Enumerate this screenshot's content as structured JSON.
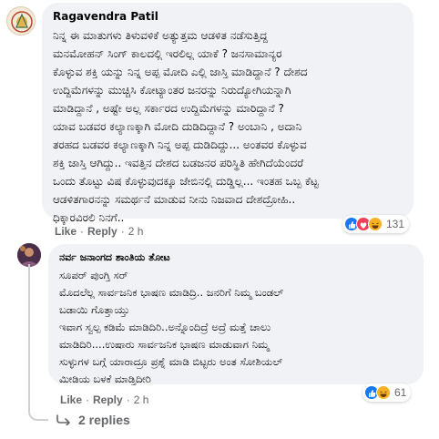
{
  "comment1": {
    "author": "Ragavendra Patil",
    "text": "ನಿನ್ನ ಈ ಮಾತುಗಳು ತಿಳುವಳಿಕೆ ಅತ್ಯುತ್ತಮ ಆಡಳಿತ ನಡೆಸುತ್ತಿದ್ದ\nಮನಮೋಹನ್ ಸಿಂಗ್ ಕಾಲದಲ್ಲಿ ಇರಲಿಲ್ಲ ಯಾಕೆ ? ಜನಸಾಮಾನ್ಯರ\nಕೊಳ್ಳುವ ಶಕ್ತಿ ಯನ್ನು ನಿನ್ನ ಅಪ್ಪ ಮೋದಿ ಎಲ್ಲಿ ಜಾಸ್ತಿ ಮಾಡಿದ್ದಾನೆ ? ದೇಶದ\nಉದ್ದಿಮೆಗಳನ್ನು ಮುಚ್ಚಿಸಿ ಕೋಟ್ಯಾಂತರ ಜನರನ್ನು ನಿರುದ್ಯೋಗಿಯನ್ನಾಗಿ\nಮಾಡಿದ್ದಾನೆ , ಅಷ್ಟೇ ಅಲ್ಲ ಸರ್ಕಾರದ ಉದ್ದಿಮೆಗಳನ್ನು ಮಾರಿದ್ದಾನೆ ?\nಯಾವ ಬಡವರ ಕಲ್ಯಾಣಕ್ಕಾಗಿ ಮೋದಿ ದುಡಿದಿದ್ದಾನೆ ? ಅಂಬಾನಿ , ಅದಾನಿ\nತರಹದ ಬಡವರ ಕಲ್ಯಾಣಕ್ಕಾಗಿ ನಿನ್ನ ಅಪ್ಪ ದುಡಿದಿದ್ದು... ಅಂತವರ ಕೊಳ್ಳುವ\nಶಕ್ತಿ ಜಾಸ್ತಿ ಆಗಿದ್ದು.. ಇವತ್ತಿನ ದೇಶದ ಬಡಜನರ ಪರಿಸ್ಥಿತಿ ಹೇಗಿದೆಯೆಂದರೆ\nಒಂದು ತೊಟ್ಟು ವಿಷ ಕೊಳ್ಳುವುದಕ್ಕೂ ಜೇಬಿನಲ್ಲಿ ದುಡ್ಡಿಲ್ಲ... ಇಂತಹ ಒಬ್ಬ ಕೆಟ್ಟ\nಆಡಳಿತಗಾರನನ್ನು ಸಮರ್ಥನೆ ಮಾಡುವ ನೀನು ನಿಜವಾದ ದೇಶದ್ರೋಹಿ..\nಧಿಕ್ಕಾರವಿರಲಿ ನಿನಗೆ..",
    "like_label": "Like",
    "reply_label": "Reply",
    "separator": "·",
    "time": "2 h",
    "reaction_count": "131",
    "reactions": [
      "like",
      "love",
      "haha"
    ]
  },
  "comment2": {
    "author": "ನರ್ವ ಜನಾಂಗದ ಶಾಂತಿಯ ತೋಟ",
    "text": "ಸೂಪರ್ ಪುಂಗ್ತಿ ಸರ್\nಮೊದಲೆಲ್ಲ ಸಾರ್ವಜನಿಕ ಭಾಷಣ ಮಾಡಿದ್ರಿ.. ಜನರಿಗೆ ನಿಮ್ಮ ಬಂಡಲ್\nಬಡಾಯಿ ಗೊತ್ತಾಯ್ತು\nಇವಾಗ ಸ್ವಲ್ಪ ಕಡಿಮೆ ಮಾಡಿದಿರಿ..ಅನ್ನೊಂದಿದ್ರೆ ಅದ್ರೆ ಮತ್ತೆ ಚಾಲು\nಮಾಡಿದಿರಿ....ಉಷಾರು ಸಾರ್ವಜನಿಕ ಭಾಷಣ ಮಾಡುವಾಗ ನಿಮ್ಮ\nಸುಳ್ಳುಗಳ ಬಗ್ಗೆ ಯಾರಾದ್ರೂ ಪ್ರಶ್ನೆ ಮಾಡಿ ಬಿಟ್ಟರು ಅಂತ ಸೋಶಿಯಲ್\nಮೀಡಿಯ ಬಳಕೆ ಮಾಡ್ತಿದೀರಿ",
    "like_label": "Like",
    "reply_label": "Reply",
    "separator": "·",
    "time": "2 h",
    "reaction_count": "61",
    "reactions": [
      "like",
      "haha"
    ]
  },
  "replies": {
    "label": "2 replies"
  },
  "colors": {
    "like": "#1877f2",
    "love": "#f33e58",
    "haha": "#f7b125",
    "meta_text": "#65676b",
    "bubble_bg": "#f0f2f5"
  }
}
